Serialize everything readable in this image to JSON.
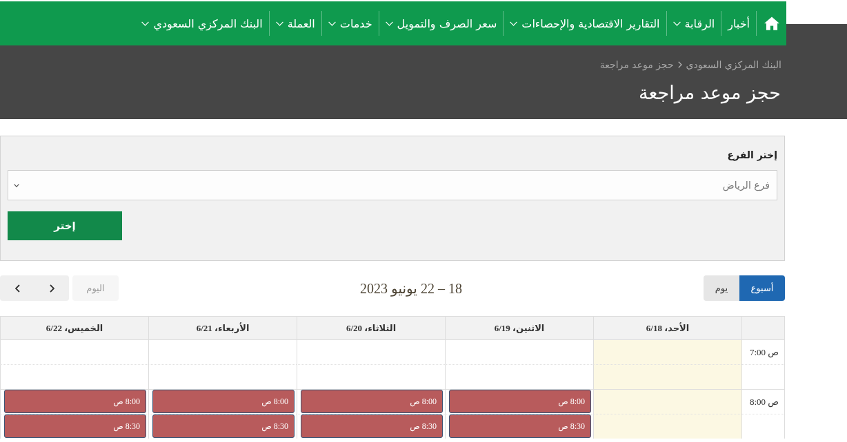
{
  "nav": {
    "items": [
      {
        "kind": "home"
      },
      {
        "kind": "link",
        "label": "أخبار",
        "has_dropdown": false
      },
      {
        "kind": "link",
        "label": "الرقابة",
        "has_dropdown": true
      },
      {
        "kind": "link",
        "label": "التقارير الاقتصادية والإحصاءات",
        "has_dropdown": true
      },
      {
        "kind": "link",
        "label": "سعر الصرف والتمويل",
        "has_dropdown": true
      },
      {
        "kind": "link",
        "label": "خدمات",
        "has_dropdown": true
      },
      {
        "kind": "link",
        "label": "العملة",
        "has_dropdown": true
      },
      {
        "kind": "link",
        "label": "البنك المركزي السعودي",
        "has_dropdown": true
      }
    ]
  },
  "breadcrumb": [
    {
      "label": "البنك المركزي السعودي"
    },
    {
      "label": "حجز موعد مراجعة"
    }
  ],
  "page_title": "حجز موعد مراجعة",
  "branch_form": {
    "label": "إختر الفرع",
    "select": {
      "value": "فرع الرياض"
    },
    "submit_button": "إختر"
  },
  "calendar": {
    "views": [
      {
        "label": "أسبوع",
        "selected": true
      },
      {
        "label": "يوم",
        "selected": false
      }
    ],
    "title": "18 – 22 يونيو 2023",
    "today_button": {
      "label": "اليوم",
      "disabled": true
    },
    "days": [
      {
        "label": "الأحد، 6/18",
        "today": true
      },
      {
        "label": "الاثنين، 6/19",
        "today": false
      },
      {
        "label": "الثلاثاء، 6/20",
        "today": false
      },
      {
        "label": "الأربعاء، 6/21",
        "today": false
      },
      {
        "label": "الخميس، 6/22",
        "today": false
      }
    ],
    "slots": [
      {
        "axis_label": "7:00 ص",
        "half_hour": false,
        "cells": [
          {
            "booked": false
          },
          {
            "booked": false
          },
          {
            "booked": false
          },
          {
            "booked": false
          },
          {
            "booked": false
          }
        ]
      },
      {
        "half_hour": true,
        "cells": [
          {
            "booked": false
          },
          {
            "booked": false
          },
          {
            "booked": false
          },
          {
            "booked": false
          },
          {
            "booked": false
          }
        ]
      },
      {
        "axis_label": "8:00 ص",
        "half_hour": false,
        "cells": [
          {
            "booked": false
          },
          {
            "booked": true,
            "event": "8:00 ص"
          },
          {
            "booked": true,
            "event": "8:00 ص"
          },
          {
            "booked": true,
            "event": "8:00 ص"
          },
          {
            "booked": true,
            "event": "8:00 ص"
          }
        ]
      },
      {
        "half_hour": true,
        "cells": [
          {
            "booked": false
          },
          {
            "booked": true,
            "event": "8:30 ص"
          },
          {
            "booked": true,
            "event": "8:30 ص"
          },
          {
            "booked": true,
            "event": "8:30 ص"
          },
          {
            "booked": true,
            "event": "8:30 ص"
          }
        ]
      }
    ]
  }
}
